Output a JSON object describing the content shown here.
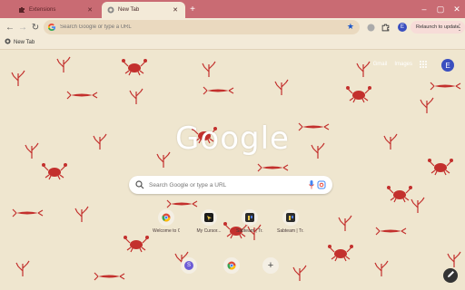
{
  "tabs": [
    {
      "label": "Extensions",
      "active": false
    },
    {
      "label": "New Tab",
      "active": true
    }
  ],
  "window": {
    "minimize_icon": "minimize-icon",
    "maximize_icon": "maximize-icon",
    "close_icon": "close-icon"
  },
  "toolbar": {
    "omnibox_placeholder": "Search Google or type a URL",
    "relaunch_label": "Relaunch to update",
    "profile_initial": "E"
  },
  "bookmarks": [
    {
      "label": "New Tab"
    }
  ],
  "ntp": {
    "links": [
      "Gmail",
      "Images"
    ],
    "avatar_initial": "E",
    "logo_text": "Google",
    "search_placeholder": "Search Google or type a URL",
    "shortcuts": [
      {
        "label": "Welcome to Chrome",
        "icon": "chrome-icon",
        "color": "#dd4b39"
      },
      {
        "label": "My Cursor...",
        "icon": "cursor-icon",
        "color": "#1b1b1b"
      },
      {
        "label": "Sabteam | Tr...",
        "icon": "sabteam-icon",
        "color": "#2b2b2b"
      },
      {
        "label": "Sabteam | Tr...",
        "icon": "sabteam-icon",
        "color": "#2b2b2b"
      },
      {
        "label": "",
        "icon": "s-app-icon",
        "color": "#6d5cd6"
      },
      {
        "label": "",
        "icon": "chrome-icon",
        "color": "#dd4b39"
      },
      {
        "label": "",
        "icon": "add-icon",
        "color": "#444444"
      }
    ]
  },
  "colors": {
    "tabstrip": "#c96b73",
    "toolbar": "#f3ead8",
    "background": "#efe6cf",
    "pattern_red": "#c3302d",
    "accent_blue": "#1a56c9"
  }
}
